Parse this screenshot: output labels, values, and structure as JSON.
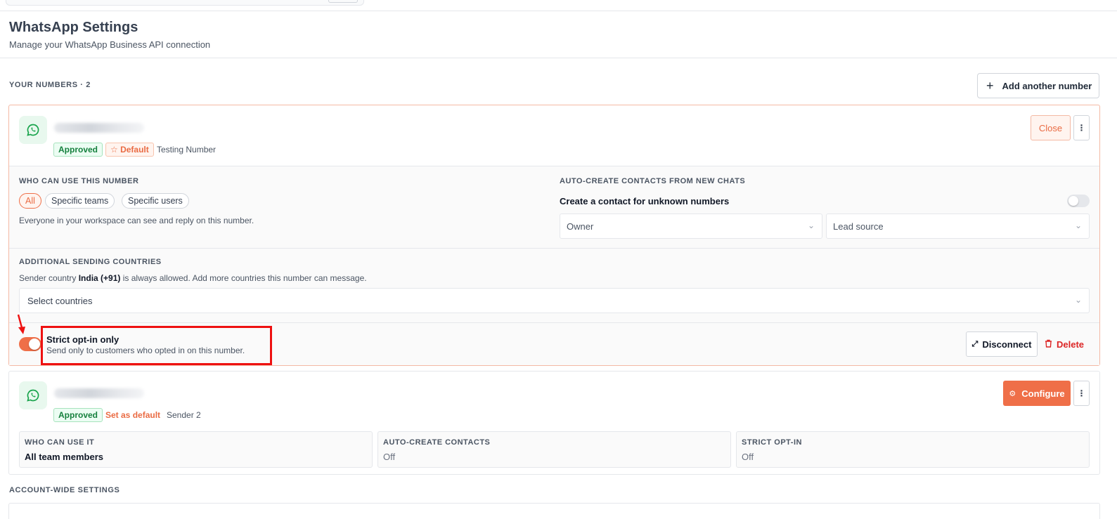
{
  "header": {
    "title": "WhatsApp Settings",
    "subtitle": "Manage your WhatsApp Business API connection"
  },
  "numbers_section": {
    "label": "YOUR NUMBERS · 2",
    "add_button": "Add another number"
  },
  "number_1": {
    "status_badge": "Approved",
    "default_badge": "Default",
    "name": "Testing Number",
    "close_button": "Close",
    "who_can_use": {
      "label": "WHO CAN USE THIS NUMBER",
      "options": [
        "All",
        "Specific teams",
        "Specific users"
      ],
      "selected": "All",
      "helper": "Everyone in your workspace can see and reply on this number."
    },
    "auto_create": {
      "label": "AUTO-CREATE CONTACTS FROM NEW CHATS",
      "title": "Create a contact for unknown numbers",
      "enabled": false,
      "owner_placeholder": "Owner",
      "lead_source_placeholder": "Lead source"
    },
    "countries": {
      "label": "ADDITIONAL SENDING COUNTRIES",
      "helper_prefix": "Sender country ",
      "helper_country": "India (+91)",
      "helper_suffix": " is always allowed. Add more countries this number can message.",
      "select_placeholder": "Select countries"
    },
    "strict_optin": {
      "enabled": true,
      "title": "Strict opt-in only",
      "description": "Send only to customers who opted in on this number."
    },
    "disconnect_button": "Disconnect",
    "delete_button": "Delete"
  },
  "number_2": {
    "status_badge": "Approved",
    "set_default_link": "Set as default",
    "name": "Sender 2",
    "configure_button": "Configure",
    "stats": [
      {
        "label": "WHO CAN USE IT",
        "value": "All team members"
      },
      {
        "label": "AUTO-CREATE CONTACTS",
        "value": "Off"
      },
      {
        "label": "STRICT OPT-IN",
        "value": "Off"
      }
    ]
  },
  "account_section": {
    "label": "ACCOUNT-WIDE SETTINGS"
  },
  "colors": {
    "accent": "#ef6f48",
    "approved": "#15803d",
    "danger": "#dc2626",
    "annotation": "#ee1111"
  }
}
